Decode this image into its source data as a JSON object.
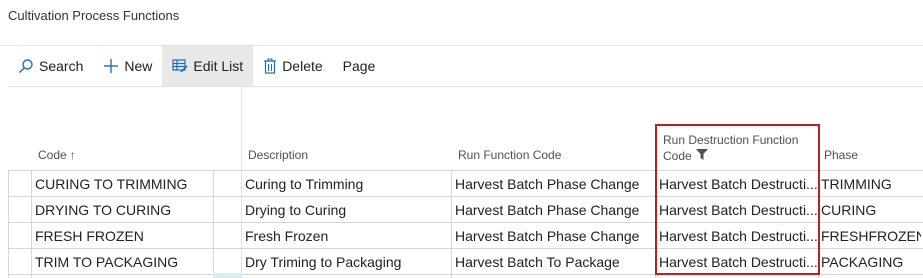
{
  "page": {
    "title": "Cultivation Process Functions"
  },
  "toolbar": {
    "search_label": "Search",
    "new_label": "New",
    "edit_list_label": "Edit List",
    "delete_label": "Delete",
    "page_label": "Page",
    "icons": [
      "search-icon",
      "plus-icon",
      "edit-list-icon",
      "trash-icon"
    ]
  },
  "table": {
    "headers": {
      "code": "Code",
      "code_sort": "↑",
      "description": "Description",
      "run_function_code": "Run Function Code",
      "run_destruction_line1": "Run Destruction Function",
      "run_destruction_line2": "Code",
      "phase": "Phase"
    },
    "rows": [
      {
        "code": "CURING TO TRIMMING",
        "description": "Curing to Trimming",
        "run_function_code": "Harvest Batch Phase Change",
        "run_destruction": "Harvest Batch Destructi...",
        "phase": "TRIMMING"
      },
      {
        "code": "DRYING TO CURING",
        "description": "Drying to Curing",
        "run_function_code": "Harvest Batch Phase Change",
        "run_destruction": "Harvest Batch Destructi...",
        "phase": "CURING"
      },
      {
        "code": "FRESH FROZEN",
        "description": "Fresh Frozen",
        "run_function_code": "Harvest Batch Phase Change",
        "run_destruction": "Harvest Batch Destructi...",
        "phase": "FRESHFROZEN"
      },
      {
        "code": "TRIM TO PACKAGING",
        "description": "Dry Triming to Packaging",
        "run_function_code": "Harvest Batch To Package",
        "run_destruction": "Harvest Batch Destructi...",
        "phase": "PACKAGING"
      }
    ]
  },
  "colors": {
    "highlight_border": "#b22222",
    "active_button_bg": "#e8e8e8",
    "accent": "#0f6cbd"
  }
}
